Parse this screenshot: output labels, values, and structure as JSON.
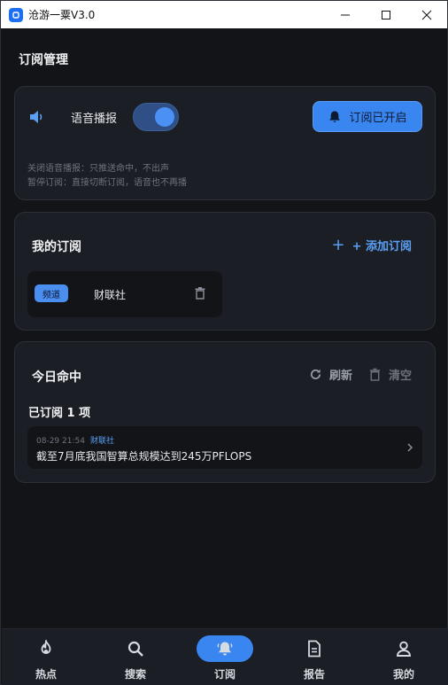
{
  "window": {
    "title": "沧游一粟V3.0"
  },
  "page": {
    "title": "订阅管理"
  },
  "settings_card": {
    "voice_label": "语音播报",
    "voice_enabled": true,
    "subscribe_button": "订阅已开启",
    "hint_1": "关闭语音播报：只推送命中，不出声",
    "hint_2": "暂停订阅：直接切断订阅，语音也不再播"
  },
  "my_subs": {
    "title": "我的订阅",
    "add_button": "+ 添加订阅",
    "items": [
      {
        "tag": "频道",
        "name": "财联社"
      }
    ]
  },
  "today_hits": {
    "title": "今日命中",
    "refresh_label": "刷新",
    "clear_label": "清空",
    "count_text": "已订阅 1 项",
    "news": [
      {
        "time": "08-29 21:54",
        "source": "财联社",
        "title": "截至7月底我国智算总规模达到245万PFLOPS"
      }
    ]
  },
  "tabbar": {
    "tabs": [
      {
        "label": "热点",
        "icon": "fire-icon"
      },
      {
        "label": "搜索",
        "icon": "search-icon"
      },
      {
        "label": "订阅",
        "icon": "bell-icon",
        "active": true
      },
      {
        "label": "报告",
        "icon": "document-icon"
      },
      {
        "label": "我的",
        "icon": "user-icon"
      }
    ]
  },
  "colors": {
    "accent": "#3a86f0",
    "background": "#121418",
    "card": "#1b1e24"
  }
}
